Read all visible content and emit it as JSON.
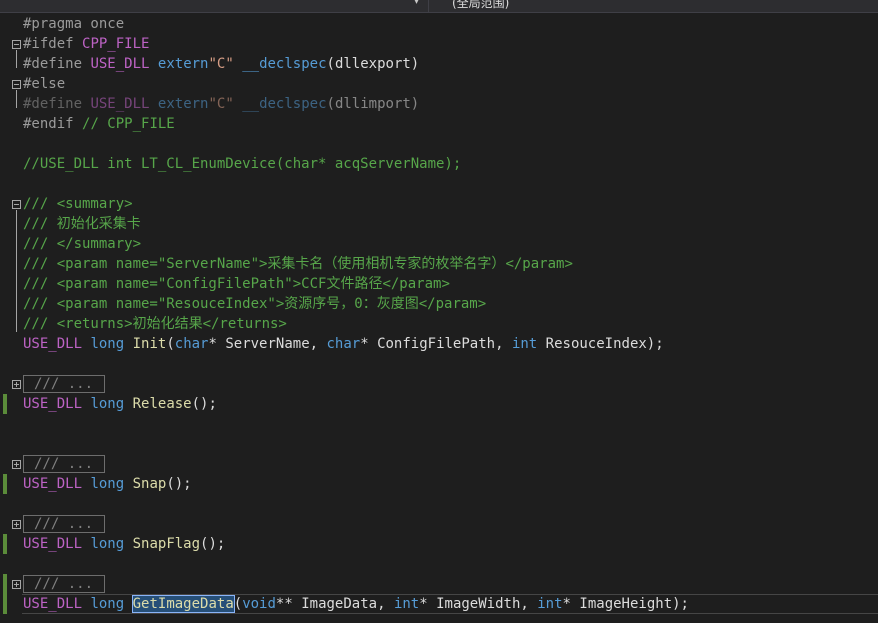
{
  "topbar": {
    "dropdown_icon": "chevron-down-icon",
    "scope_label": "(全局范围)"
  },
  "code": {
    "l1": "#pragma once",
    "l2_kw": "#ifdef",
    "l2_macro": "CPP_FILE",
    "l3_kw": "#define",
    "l3_macro": "USE_DLL",
    "l3_extern": "extern",
    "l3_str": "\"C\"",
    "l3_decl": "__declspec",
    "l3_arg": "(dllexport)",
    "l4": "#else",
    "l5_kw": "#define",
    "l5_macro": "USE_DLL",
    "l5_extern": "extern",
    "l5_str": "\"C\"",
    "l5_decl": "__declspec",
    "l5_arg": "(dllimport)",
    "l6_kw": "#endif",
    "l6_cm": "// CPP_FILE",
    "l8": "//USE_DLL int LT_CL_EnumDevice(char* acqServerName);",
    "doc1": "/// <summary>",
    "doc2": "/// 初始化采集卡",
    "doc3": "/// </summary>",
    "doc4_a": "/// <param name=\"ServerName\">",
    "doc4_b": "采集卡名（使用相机专家的枚举名字）",
    "doc4_c": "</param>",
    "doc5_a": "/// <param name=\"ConfigFilePath\">",
    "doc5_b": "CCF文件路径",
    "doc5_c": "</param>",
    "doc6_a": "/// <param name=\"ResouceIndex\">",
    "doc6_b": "资源序号，0：灰度图",
    "doc6_c": "</param>",
    "doc7_a": "/// <returns>",
    "doc7_b": "初始化结果",
    "doc7_c": "</returns>",
    "init_macro": "USE_DLL",
    "init_long": "long",
    "init_fn": "Init",
    "init_p1t": "char",
    "init_p1": "* ServerName, ",
    "init_p2t": "char",
    "init_p2": "* ConfigFilePath, ",
    "init_p3t": "int",
    "init_p3": " ResouceIndex);",
    "collapsed": "/// ...",
    "release_macro": "USE_DLL",
    "release_long": "long",
    "release_fn": "Release",
    "release_tail": "();",
    "snap_macro": "USE_DLL",
    "snap_long": "long",
    "snap_fn": "Snap",
    "snap_tail": "();",
    "snapflag_macro": "USE_DLL",
    "snapflag_long": "long",
    "snapflag_fn": "SnapFlag",
    "snapflag_tail": "();",
    "gid_macro": "USE_DLL",
    "gid_long": "long",
    "gid_fn": "GetImageData",
    "gid_p1t": "void",
    "gid_p1": "** ImageData, ",
    "gid_p2t": "int",
    "gid_p2": "* ImageWidth, ",
    "gid_p3t": "int",
    "gid_p3": "* ImageHeight);"
  }
}
